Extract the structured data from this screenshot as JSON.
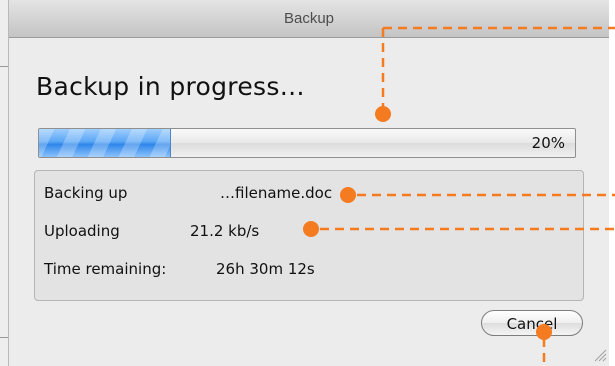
{
  "window": {
    "title": "Backup"
  },
  "dialog": {
    "heading": "Backup in progress…",
    "progress": {
      "percent_label": "20%",
      "fraction": 0.245
    },
    "details": [
      {
        "label": "Backing up",
        "value": "…filename.doc"
      },
      {
        "label": "Uploading",
        "value": "21.2 kb/s"
      },
      {
        "label": "Time remaining:",
        "value": "26h 30m 12s"
      }
    ],
    "cancel_label": "Cancel"
  },
  "colors": {
    "callout": "#f47b20",
    "progress_fill": "#3d8fef",
    "window_bg": "#ececec"
  }
}
